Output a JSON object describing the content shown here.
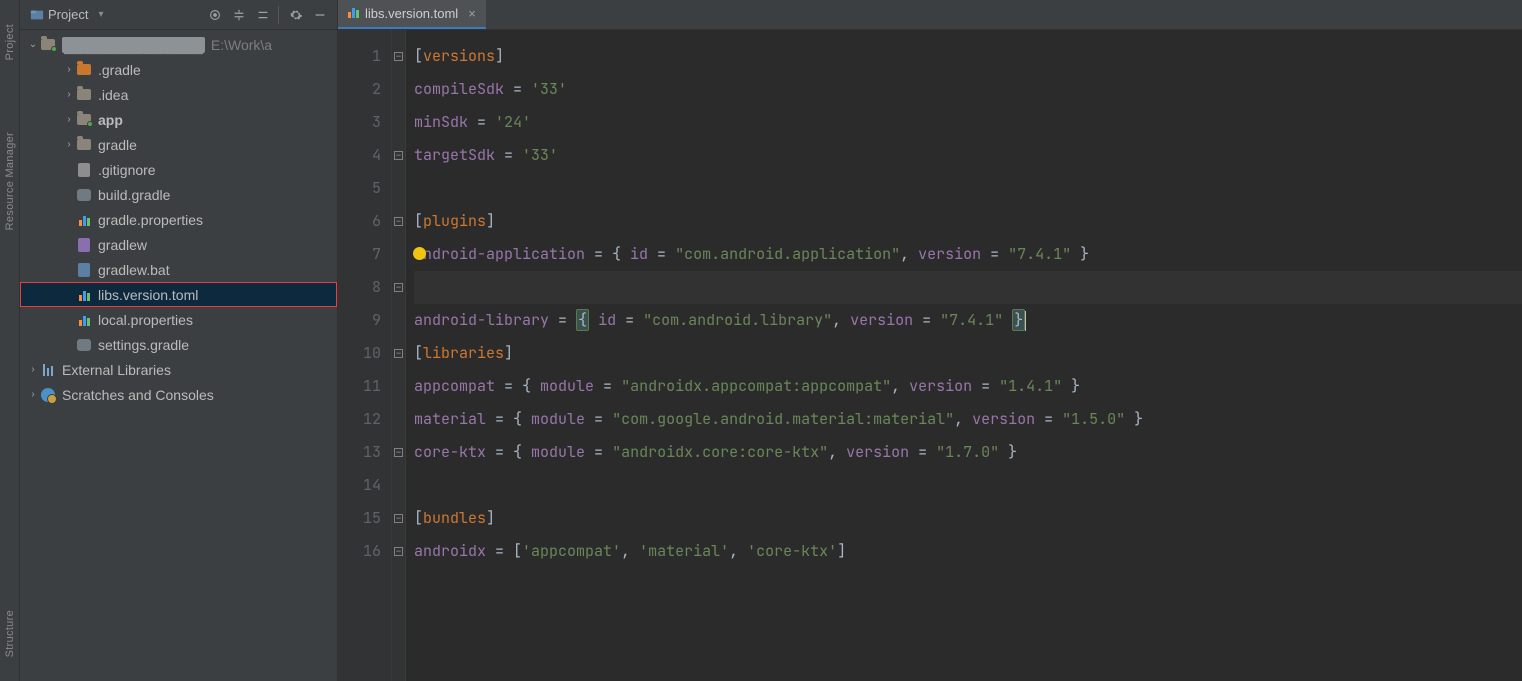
{
  "leftbar": {
    "tabs": [
      "Project",
      "Resource Manager",
      "Structure"
    ]
  },
  "sidebar": {
    "title": "Project",
    "root": {
      "path_hint": "E:\\Work\\a"
    },
    "items": [
      {
        "label": ".gradle",
        "kind": "folder-orange",
        "expandable": true
      },
      {
        "label": ".idea",
        "kind": "folder",
        "expandable": true
      },
      {
        "label": "app",
        "kind": "folder-dot",
        "expandable": true,
        "bold": true
      },
      {
        "label": "gradle",
        "kind": "folder",
        "expandable": true
      },
      {
        "label": ".gitignore",
        "kind": "file"
      },
      {
        "label": "build.gradle",
        "kind": "elephant"
      },
      {
        "label": "gradle.properties",
        "kind": "bars"
      },
      {
        "label": "gradlew",
        "kind": "file-purple"
      },
      {
        "label": "gradlew.bat",
        "kind": "file-blue"
      },
      {
        "label": "libs.version.toml",
        "kind": "bars",
        "selected": true,
        "highlight": true
      },
      {
        "label": "local.properties",
        "kind": "bars"
      },
      {
        "label": "settings.gradle",
        "kind": "elephant"
      }
    ],
    "extras": [
      {
        "label": "External Libraries",
        "kind": "liblines",
        "expandable": true
      },
      {
        "label": "Scratches and Consoles",
        "kind": "scratch",
        "expandable": true
      }
    ]
  },
  "editor": {
    "tab": {
      "label": "libs.version.toml"
    },
    "current_line": 8,
    "lines": [
      {
        "n": 1,
        "fold": "open",
        "seg": [
          {
            "t": "[",
            "c": "punct"
          },
          {
            "t": "versions",
            "c": "orange"
          },
          {
            "t": "]",
            "c": "punct"
          }
        ]
      },
      {
        "n": 2,
        "seg": [
          {
            "t": "compileSdk",
            "c": "purple"
          },
          {
            "t": " = ",
            "c": "white"
          },
          {
            "t": "'33'",
            "c": "str"
          }
        ]
      },
      {
        "n": 3,
        "seg": [
          {
            "t": "minSdk",
            "c": "purple"
          },
          {
            "t": " = ",
            "c": "white"
          },
          {
            "t": "'24'",
            "c": "str"
          }
        ]
      },
      {
        "n": 4,
        "fold": "close",
        "seg": [
          {
            "t": "targetSdk",
            "c": "purple"
          },
          {
            "t": " = ",
            "c": "white"
          },
          {
            "t": "'33'",
            "c": "str"
          }
        ]
      },
      {
        "n": 5,
        "seg": []
      },
      {
        "n": 6,
        "fold": "open",
        "seg": [
          {
            "t": "[",
            "c": "punct"
          },
          {
            "t": "plugins",
            "c": "orange"
          },
          {
            "t": "]",
            "c": "punct"
          }
        ]
      },
      {
        "n": 7,
        "bulb": true,
        "seg": [
          {
            "t": "android-application",
            "c": "purple"
          },
          {
            "t": " = { ",
            "c": "white"
          },
          {
            "t": "id",
            "c": "purple"
          },
          {
            "t": " = ",
            "c": "white"
          },
          {
            "t": "\"com.android.application\"",
            "c": "str"
          },
          {
            "t": ", ",
            "c": "white"
          },
          {
            "t": "version",
            "c": "purple"
          },
          {
            "t": " = ",
            "c": "white"
          },
          {
            "t": "\"7.4.1\"",
            "c": "str"
          },
          {
            "t": " }",
            "c": "white"
          }
        ]
      },
      {
        "n": 8,
        "fold": "close",
        "current": true,
        "seg": [
          {
            "t": "android-library",
            "c": "purple"
          },
          {
            "t": " = ",
            "c": "white"
          },
          {
            "t": "{",
            "c": "white",
            "match": true
          },
          {
            "t": " ",
            "c": "white"
          },
          {
            "t": "id",
            "c": "purple"
          },
          {
            "t": " = ",
            "c": "white"
          },
          {
            "t": "\"com.android.library\"",
            "c": "str"
          },
          {
            "t": ", ",
            "c": "white"
          },
          {
            "t": "version",
            "c": "purple"
          },
          {
            "t": " = ",
            "c": "white"
          },
          {
            "t": "\"7.4.1\"",
            "c": "str"
          },
          {
            "t": " ",
            "c": "white"
          },
          {
            "t": "}",
            "c": "white",
            "match": true
          }
        ]
      },
      {
        "n": 9,
        "seg": []
      },
      {
        "n": 10,
        "fold": "open",
        "seg": [
          {
            "t": "[",
            "c": "punct"
          },
          {
            "t": "libraries",
            "c": "orange"
          },
          {
            "t": "]",
            "c": "punct"
          }
        ]
      },
      {
        "n": 11,
        "seg": [
          {
            "t": "appcompat",
            "c": "purple"
          },
          {
            "t": " = { ",
            "c": "white"
          },
          {
            "t": "module",
            "c": "purple"
          },
          {
            "t": " = ",
            "c": "white"
          },
          {
            "t": "\"androidx.appcompat:appcompat\"",
            "c": "str"
          },
          {
            "t": ", ",
            "c": "white"
          },
          {
            "t": "version",
            "c": "purple"
          },
          {
            "t": " = ",
            "c": "white"
          },
          {
            "t": "\"1.4.1\"",
            "c": "str"
          },
          {
            "t": " }",
            "c": "white"
          }
        ]
      },
      {
        "n": 12,
        "seg": [
          {
            "t": "material",
            "c": "purple"
          },
          {
            "t": " = { ",
            "c": "white"
          },
          {
            "t": "module",
            "c": "purple"
          },
          {
            "t": " = ",
            "c": "white"
          },
          {
            "t": "\"com.google.android.material:material\"",
            "c": "str"
          },
          {
            "t": ", ",
            "c": "white"
          },
          {
            "t": "version",
            "c": "purple"
          },
          {
            "t": " = ",
            "c": "white"
          },
          {
            "t": "\"1.5.0\"",
            "c": "str"
          },
          {
            "t": " }",
            "c": "white"
          }
        ]
      },
      {
        "n": 13,
        "fold": "close",
        "seg": [
          {
            "t": "core-ktx",
            "c": "purple"
          },
          {
            "t": " = { ",
            "c": "white"
          },
          {
            "t": "module",
            "c": "purple"
          },
          {
            "t": " = ",
            "c": "white"
          },
          {
            "t": "\"androidx.core:core-ktx\"",
            "c": "str"
          },
          {
            "t": ", ",
            "c": "white"
          },
          {
            "t": "version",
            "c": "purple"
          },
          {
            "t": " = ",
            "c": "white"
          },
          {
            "t": "\"1.7.0\"",
            "c": "str"
          },
          {
            "t": " }",
            "c": "white"
          }
        ]
      },
      {
        "n": 14,
        "seg": []
      },
      {
        "n": 15,
        "fold": "open",
        "seg": [
          {
            "t": "[",
            "c": "punct"
          },
          {
            "t": "bundles",
            "c": "orange"
          },
          {
            "t": "]",
            "c": "punct"
          }
        ]
      },
      {
        "n": 16,
        "fold": "close",
        "seg": [
          {
            "t": "androidx",
            "c": "purple"
          },
          {
            "t": " = [",
            "c": "white"
          },
          {
            "t": "'appcompat'",
            "c": "str"
          },
          {
            "t": ", ",
            "c": "white"
          },
          {
            "t": "'material'",
            "c": "str"
          },
          {
            "t": ", ",
            "c": "white"
          },
          {
            "t": "'core-ktx'",
            "c": "str"
          },
          {
            "t": "]",
            "c": "white"
          }
        ]
      }
    ]
  }
}
